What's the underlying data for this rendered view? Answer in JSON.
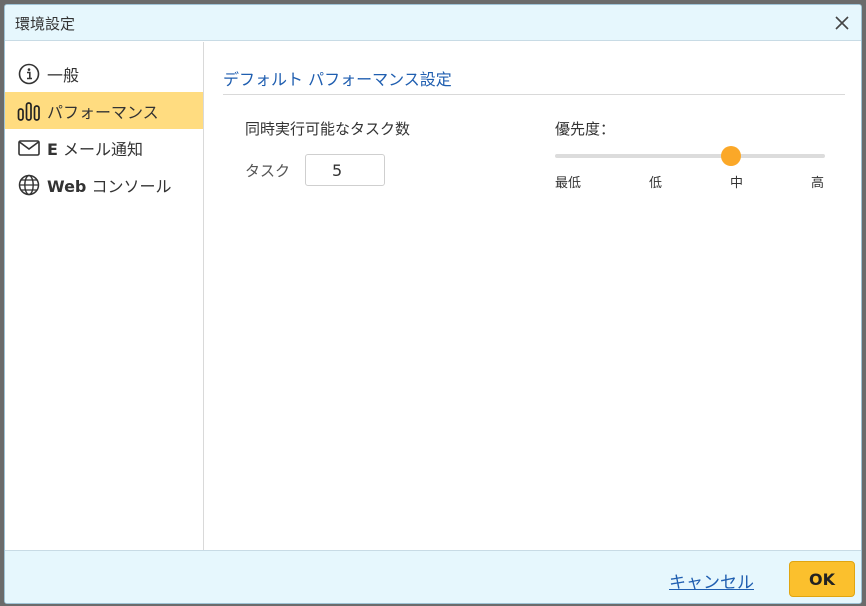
{
  "window": {
    "title": "環境設定"
  },
  "sidebar": {
    "items": [
      {
        "prefix": "",
        "label": "一般",
        "icon": "info-icon",
        "active": false
      },
      {
        "prefix": "",
        "label": "パフォーマンス",
        "icon": "bars-icon",
        "active": true
      },
      {
        "prefix": "E",
        "label": " メール通知",
        "icon": "mail-icon",
        "active": false
      },
      {
        "prefix": "Web",
        "label": " コンソール",
        "icon": "globe-icon",
        "active": false
      }
    ]
  },
  "main": {
    "section_title": "デフォルト パフォーマンス設定",
    "concurrent": {
      "label": "同時実行可能なタスク数",
      "task_label": "タスク",
      "value": "5"
    },
    "priority": {
      "label": "優先度：",
      "ticks": [
        "最低",
        "低",
        "中",
        "高"
      ],
      "selected_index": 2,
      "selected": "中",
      "accent": "#fba828"
    }
  },
  "footer": {
    "cancel": "キャンセル",
    "ok": "OK"
  },
  "colors": {
    "accent": "#fbc02d",
    "active_nav": "#ffdc80",
    "link": "#1f5eb0",
    "header_bg": "#e6f7fd"
  }
}
